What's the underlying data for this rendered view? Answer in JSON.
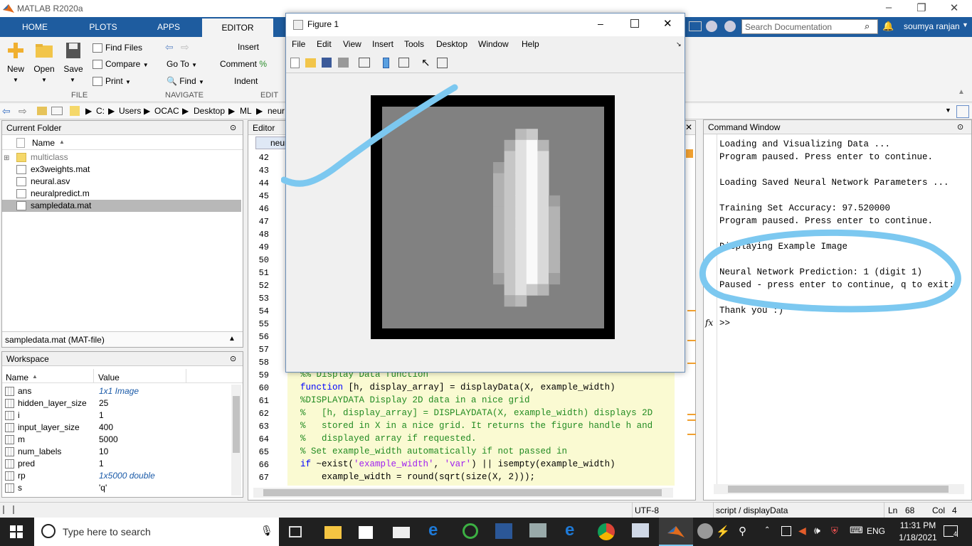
{
  "app": {
    "title": "MATLAB R2020a"
  },
  "tabs": [
    {
      "label": "HOME"
    },
    {
      "label": "PLOTS"
    },
    {
      "label": "APPS"
    },
    {
      "label": "EDITOR"
    }
  ],
  "search": {
    "placeholder": "Search Documentation"
  },
  "user": {
    "name": "soumya ranjan"
  },
  "ribbon": {
    "new": "New",
    "open": "Open",
    "save": "Save",
    "find_files": "Find Files",
    "compare": "Compare",
    "print": "Print",
    "go_to": "Go To",
    "find": "Find",
    "insert": "Insert",
    "comment": "Comment",
    "indent": "Indent",
    "group_file": "FILE",
    "group_navigate": "NAVIGATE",
    "group_edit": "EDIT"
  },
  "address": {
    "crumbs": [
      "C:",
      "Users",
      "OCAC",
      "Desktop",
      "ML",
      "neur"
    ]
  },
  "current_folder": {
    "title": "Current Folder",
    "col_name": "Name",
    "items": [
      {
        "name": "multiclass",
        "kind": "folder"
      },
      {
        "name": "ex3weights.mat",
        "kind": "mat"
      },
      {
        "name": "neural.asv",
        "kind": "file"
      },
      {
        "name": "neuralpredict.m",
        "kind": "file"
      },
      {
        "name": "sampledata.mat",
        "kind": "mat"
      }
    ],
    "details": "sampledata.mat  (MAT-file)"
  },
  "workspace": {
    "title": "Workspace",
    "col_name": "Name",
    "col_value": "Value",
    "rows": [
      {
        "name": "ans",
        "value": "1x1 Image"
      },
      {
        "name": "hidden_layer_size",
        "value": "25"
      },
      {
        "name": "i",
        "value": "1"
      },
      {
        "name": "input_layer_size",
        "value": "400"
      },
      {
        "name": "m",
        "value": "5000"
      },
      {
        "name": "num_labels",
        "value": "10"
      },
      {
        "name": "pred",
        "value": "1"
      },
      {
        "name": "rp",
        "value": "1x5000 double"
      },
      {
        "name": "s",
        "value": "'q'"
      }
    ]
  },
  "editor": {
    "title": "Editor",
    "tab": "neur",
    "line_numbers": [
      "42",
      "43",
      "44",
      "45",
      "46",
      "47",
      "48",
      "49",
      "50",
      "51",
      "52",
      "53",
      "54",
      "55",
      "56",
      "57",
      "58",
      "59",
      "60",
      "61",
      "62",
      "63",
      "64",
      "65",
      "66",
      "67"
    ],
    "code": [
      "%% Display Data function",
      "function [h, display_array] = displayData(X, example_width)",
      "%DISPLAYDATA Display 2D data in a nice grid",
      "%   [h, display_array] = DISPLAYDATA(X, example_width) displays 2D",
      "%   stored in X in a nice grid. It returns the figure handle h and",
      "%   displayed array if requested.",
      "% Set example_width automatically if not passed in",
      "if ~exist('example_width', 'var') || isempty(example_width)",
      "    example_width = round(sqrt(size(X, 2)));"
    ]
  },
  "command_window": {
    "title": "Command Window",
    "lines": [
      "Loading and Visualizing Data ...",
      "Program paused. Press enter to continue.",
      "",
      "Loading Saved Neural Network Parameters ...",
      "",
      "Training Set Accuracy: 97.520000",
      "Program paused. Press enter to continue.",
      "",
      "Displaying Example Image",
      "",
      "Neural Network Prediction: 1 (digit 1)",
      "Paused - press enter to continue, q to exit:",
      "",
      "Thank you :)"
    ],
    "prompt": ">>"
  },
  "figure": {
    "title": "Figure 1",
    "menu": [
      "File",
      "Edit",
      "View",
      "Insert",
      "Tools",
      "Desktop",
      "Window",
      "Help"
    ]
  },
  "status": {
    "encoding": "UTF-8",
    "context": "script / displayData",
    "ln_label": "Ln",
    "ln": "68",
    "col_label": "Col",
    "col": "4"
  },
  "taskbar": {
    "search_placeholder": "Type here to search",
    "lang": "ENG",
    "time": "11:31 PM",
    "date": "1/18/2021",
    "notifications": "4"
  },
  "colors": {
    "matlab_blue": "#1e5c9f",
    "highlight": "#7cc8f0",
    "taskbar": "#202020"
  }
}
